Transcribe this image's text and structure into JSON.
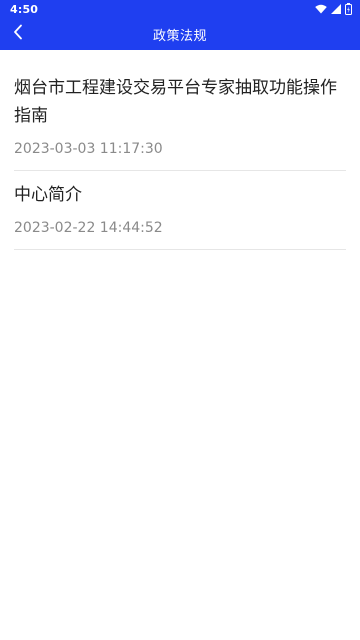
{
  "status_bar": {
    "time": "4:50",
    "icons": [
      "wifi-icon",
      "signal-icon",
      "battery-icon"
    ]
  },
  "app_bar": {
    "title": "政策法规",
    "back_icon": "chevron-left-icon",
    "background_color": "#1f3ff0"
  },
  "list": {
    "items": [
      {
        "title": "烟台市工程建设交易平台专家抽取功能操作指南",
        "date": "2023-03-03 11:17:30"
      },
      {
        "title": "中心简介",
        "date": "2023-02-22 14:44:52"
      }
    ]
  }
}
